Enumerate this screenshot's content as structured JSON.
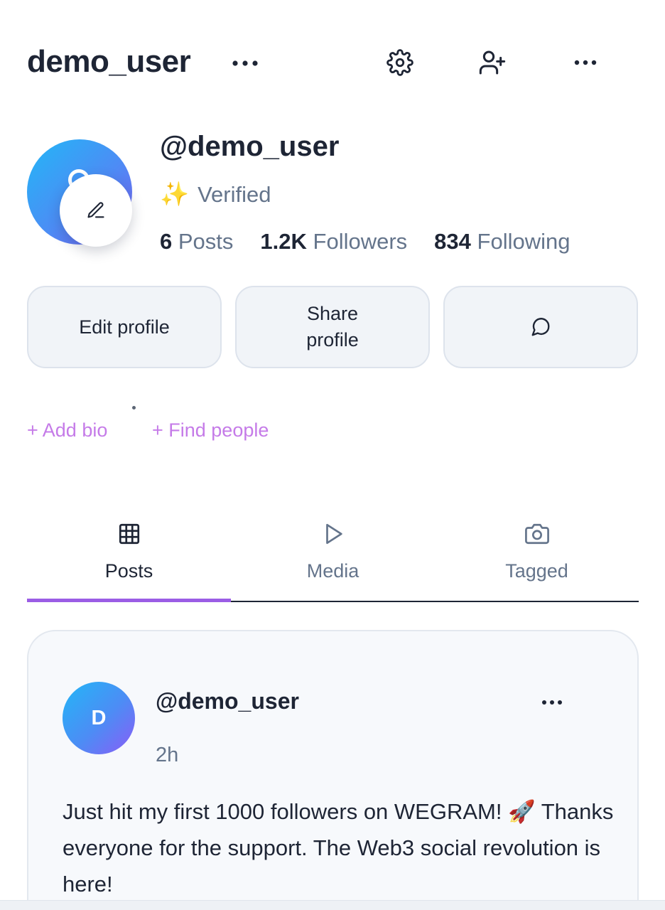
{
  "header": {
    "title": "demo_user",
    "icons": [
      "more-icon",
      "gear-icon",
      "add-user-icon",
      "more-icon"
    ]
  },
  "profile": {
    "handle": "@demo_user",
    "verified_emoji": "✨",
    "verified_label": "Verified",
    "stats": {
      "posts_count": "6",
      "posts_label": "Posts",
      "followers_count": "1.2K",
      "followers_label": "Followers",
      "following_count": "834",
      "following_label": "Following"
    }
  },
  "actions": {
    "edit_profile": "Edit profile",
    "share_profile": "Share profile"
  },
  "links": {
    "add_bio": "+ Add bio",
    "find_people": "+ Find people"
  },
  "tabs": [
    {
      "label": "Posts",
      "icon": "grid-icon",
      "active": true
    },
    {
      "label": "Media",
      "icon": "play-icon",
      "active": false
    },
    {
      "label": "Tagged",
      "icon": "camera-icon",
      "active": false
    }
  ],
  "post": {
    "avatar_initial": "D",
    "handle": "@demo_user",
    "time": "2h",
    "text": "Just hit my first 1000 followers on WEGRAM! 🚀 Thanks everyone for the support. The Web3 social revolution is here!"
  },
  "colors": {
    "accent": "#9b5de5",
    "link": "#c57be8",
    "gradient_start": "#22b7f6",
    "gradient_end": "#7a5cf0"
  }
}
